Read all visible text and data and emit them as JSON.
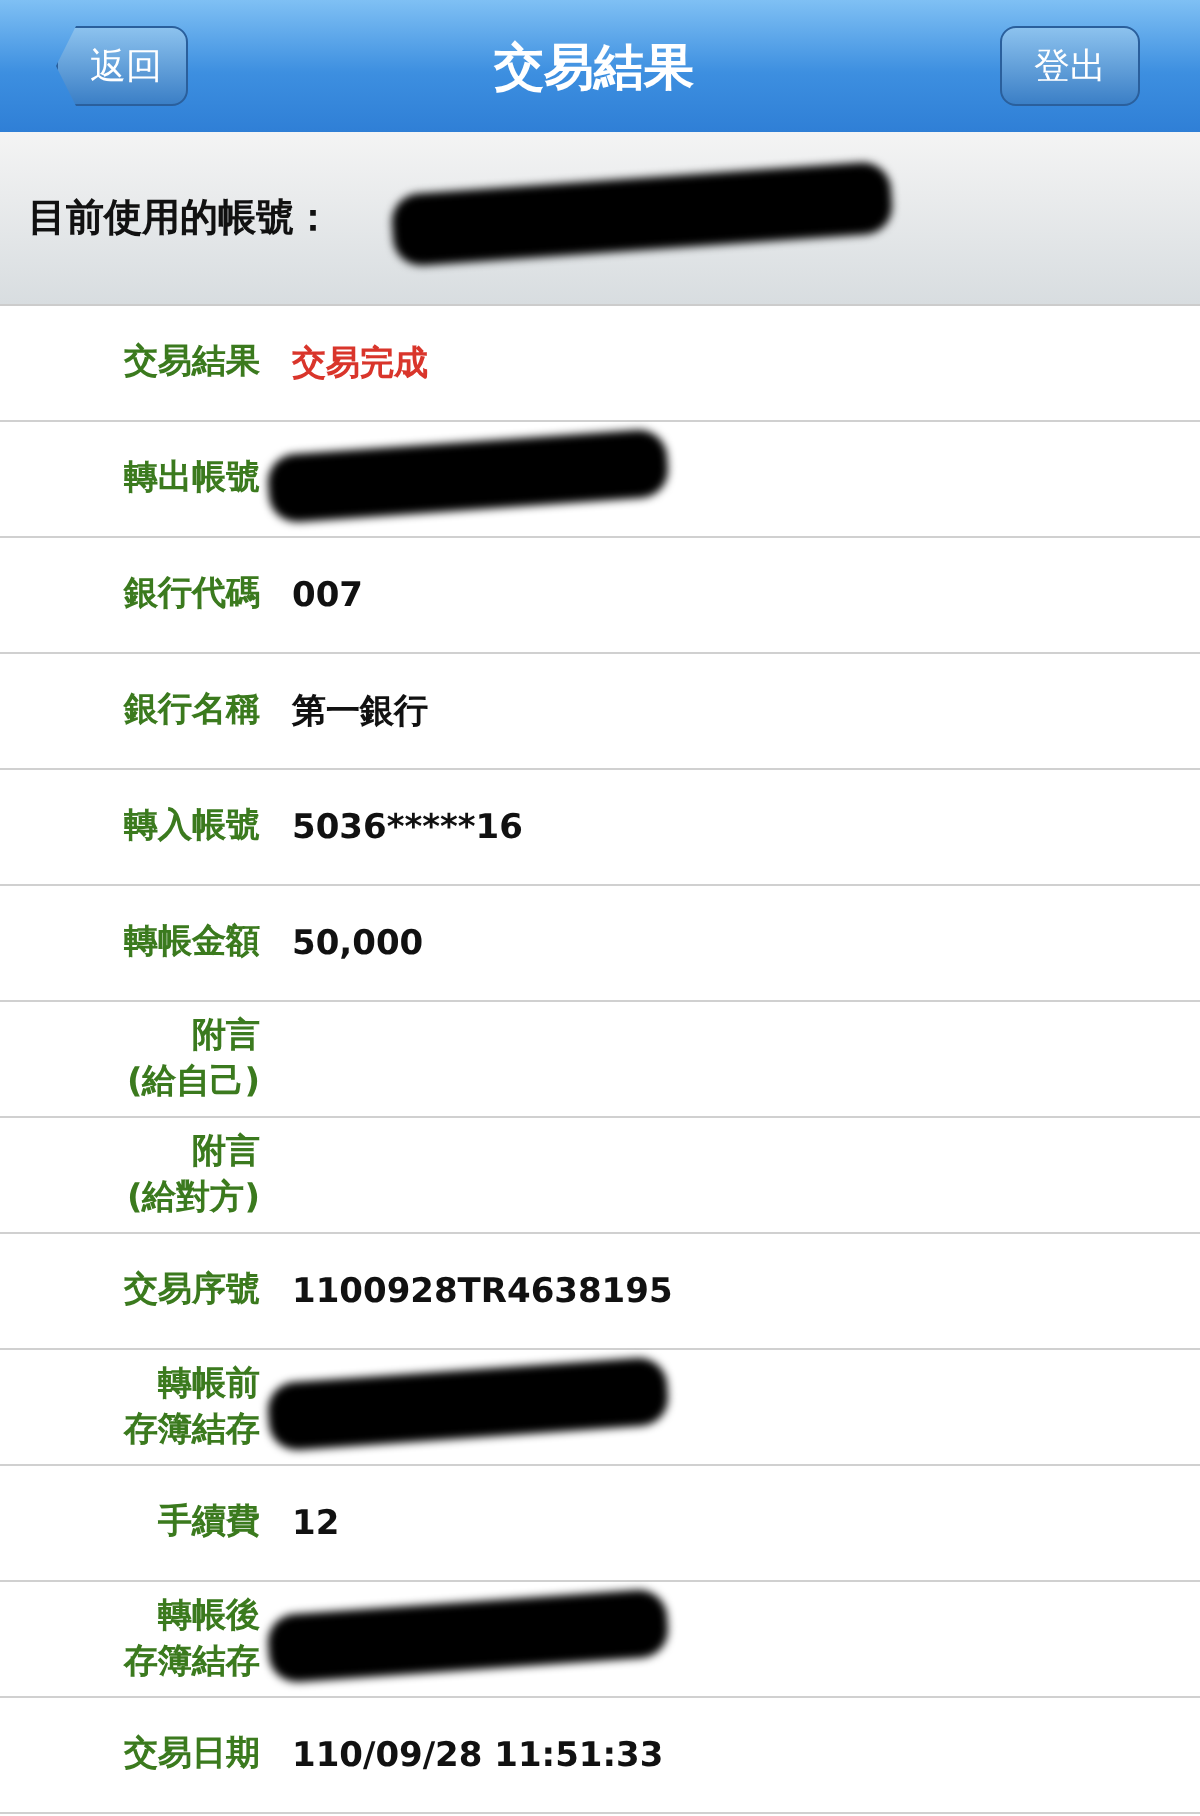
{
  "header": {
    "back_button": "返回",
    "title": "交易結果",
    "logout_button": "登出"
  },
  "account_bar": {
    "label": "目前使用的帳號：",
    "redacted": true
  },
  "rows": [
    {
      "label": "交易結果",
      "value": "交易完成",
      "kind": "status",
      "redacted": false
    },
    {
      "label": "轉出帳號",
      "value": "",
      "kind": "text",
      "redacted": true
    },
    {
      "label": "銀行代碼",
      "value": "007",
      "kind": "text",
      "redacted": false
    },
    {
      "label": "銀行名稱",
      "value": "第一銀行",
      "kind": "text",
      "redacted": false
    },
    {
      "label": "轉入帳號",
      "value": "5036*****16",
      "kind": "text",
      "redacted": false
    },
    {
      "label": "轉帳金額",
      "value": "50,000",
      "kind": "text",
      "redacted": false
    },
    {
      "label": [
        "附言",
        "(給自己)"
      ],
      "value": "",
      "kind": "text",
      "redacted": false
    },
    {
      "label": [
        "附言",
        "(給對方)"
      ],
      "value": "",
      "kind": "text",
      "redacted": false
    },
    {
      "label": "交易序號",
      "value": "1100928TR4638195",
      "kind": "text",
      "redacted": false
    },
    {
      "label": [
        "轉帳前",
        "存簿結存"
      ],
      "value": "",
      "kind": "text",
      "redacted": true
    },
    {
      "label": "手續費",
      "value": "12",
      "kind": "text",
      "redacted": false
    },
    {
      "label": [
        "轉帳後",
        "存簿結存"
      ],
      "value": "",
      "kind": "text",
      "redacted": true
    },
    {
      "label": "交易日期",
      "value": "110/09/28 11:51:33",
      "kind": "text",
      "redacted": false
    }
  ]
}
